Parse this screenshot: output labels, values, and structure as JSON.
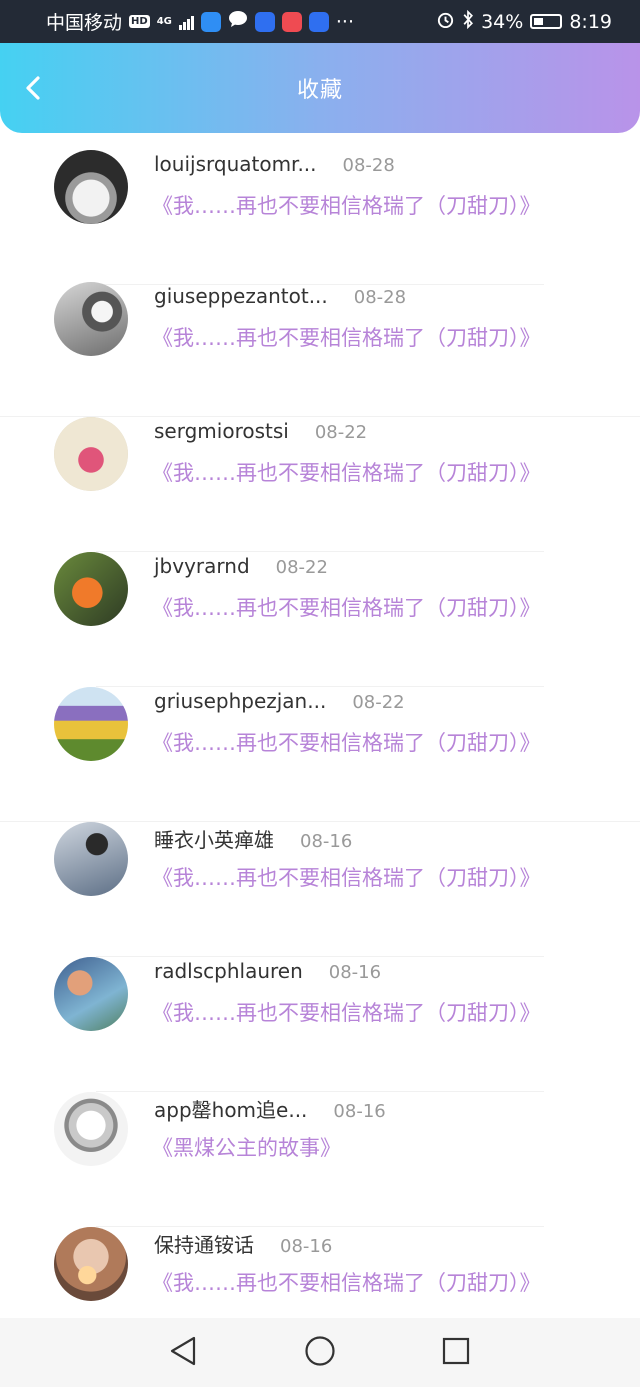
{
  "status_bar": {
    "carrier": "中国移动",
    "hd": "HD",
    "network": "4G",
    "more": "···",
    "battery": "34%",
    "time": "8:19"
  },
  "header": {
    "title": "收藏"
  },
  "items": [
    {
      "name": "louijsrquatomr...",
      "date": "08-28",
      "book": "《我……再也不要相信格瑞了（刀甜刀）》"
    },
    {
      "name": "giuseppezantot...",
      "date": "08-28",
      "book": "《我……再也不要相信格瑞了（刀甜刀）》"
    },
    {
      "name": "sergmiorostsi",
      "date": "08-22",
      "book": "《我……再也不要相信格瑞了（刀甜刀）》"
    },
    {
      "name": "jbvyrarnd",
      "date": "08-22",
      "book": "《我……再也不要相信格瑞了（刀甜刀）》"
    },
    {
      "name": "griusephpezjan...",
      "date": "08-22",
      "book": "《我……再也不要相信格瑞了（刀甜刀）》"
    },
    {
      "name": "睡衣小英瘅雄",
      "date": "08-16",
      "book": "《我……再也不要相信格瑞了（刀甜刀）》"
    },
    {
      "name": "radlscphlauren",
      "date": "08-16",
      "book": "《我……再也不要相信格瑞了（刀甜刀）》"
    },
    {
      "name": "app罄hom追e...",
      "date": "08-16",
      "book": "《黑煤公主的故事》"
    },
    {
      "name": "保持通铵话",
      "date": "08-16",
      "book": "《我……再也不要相信格瑞了（刀甜刀）》"
    }
  ],
  "colors": {
    "header_gradient_start": "#45d1f2",
    "header_gradient_end": "#b993e9",
    "book_title": "#b784d8",
    "date": "#999999"
  }
}
